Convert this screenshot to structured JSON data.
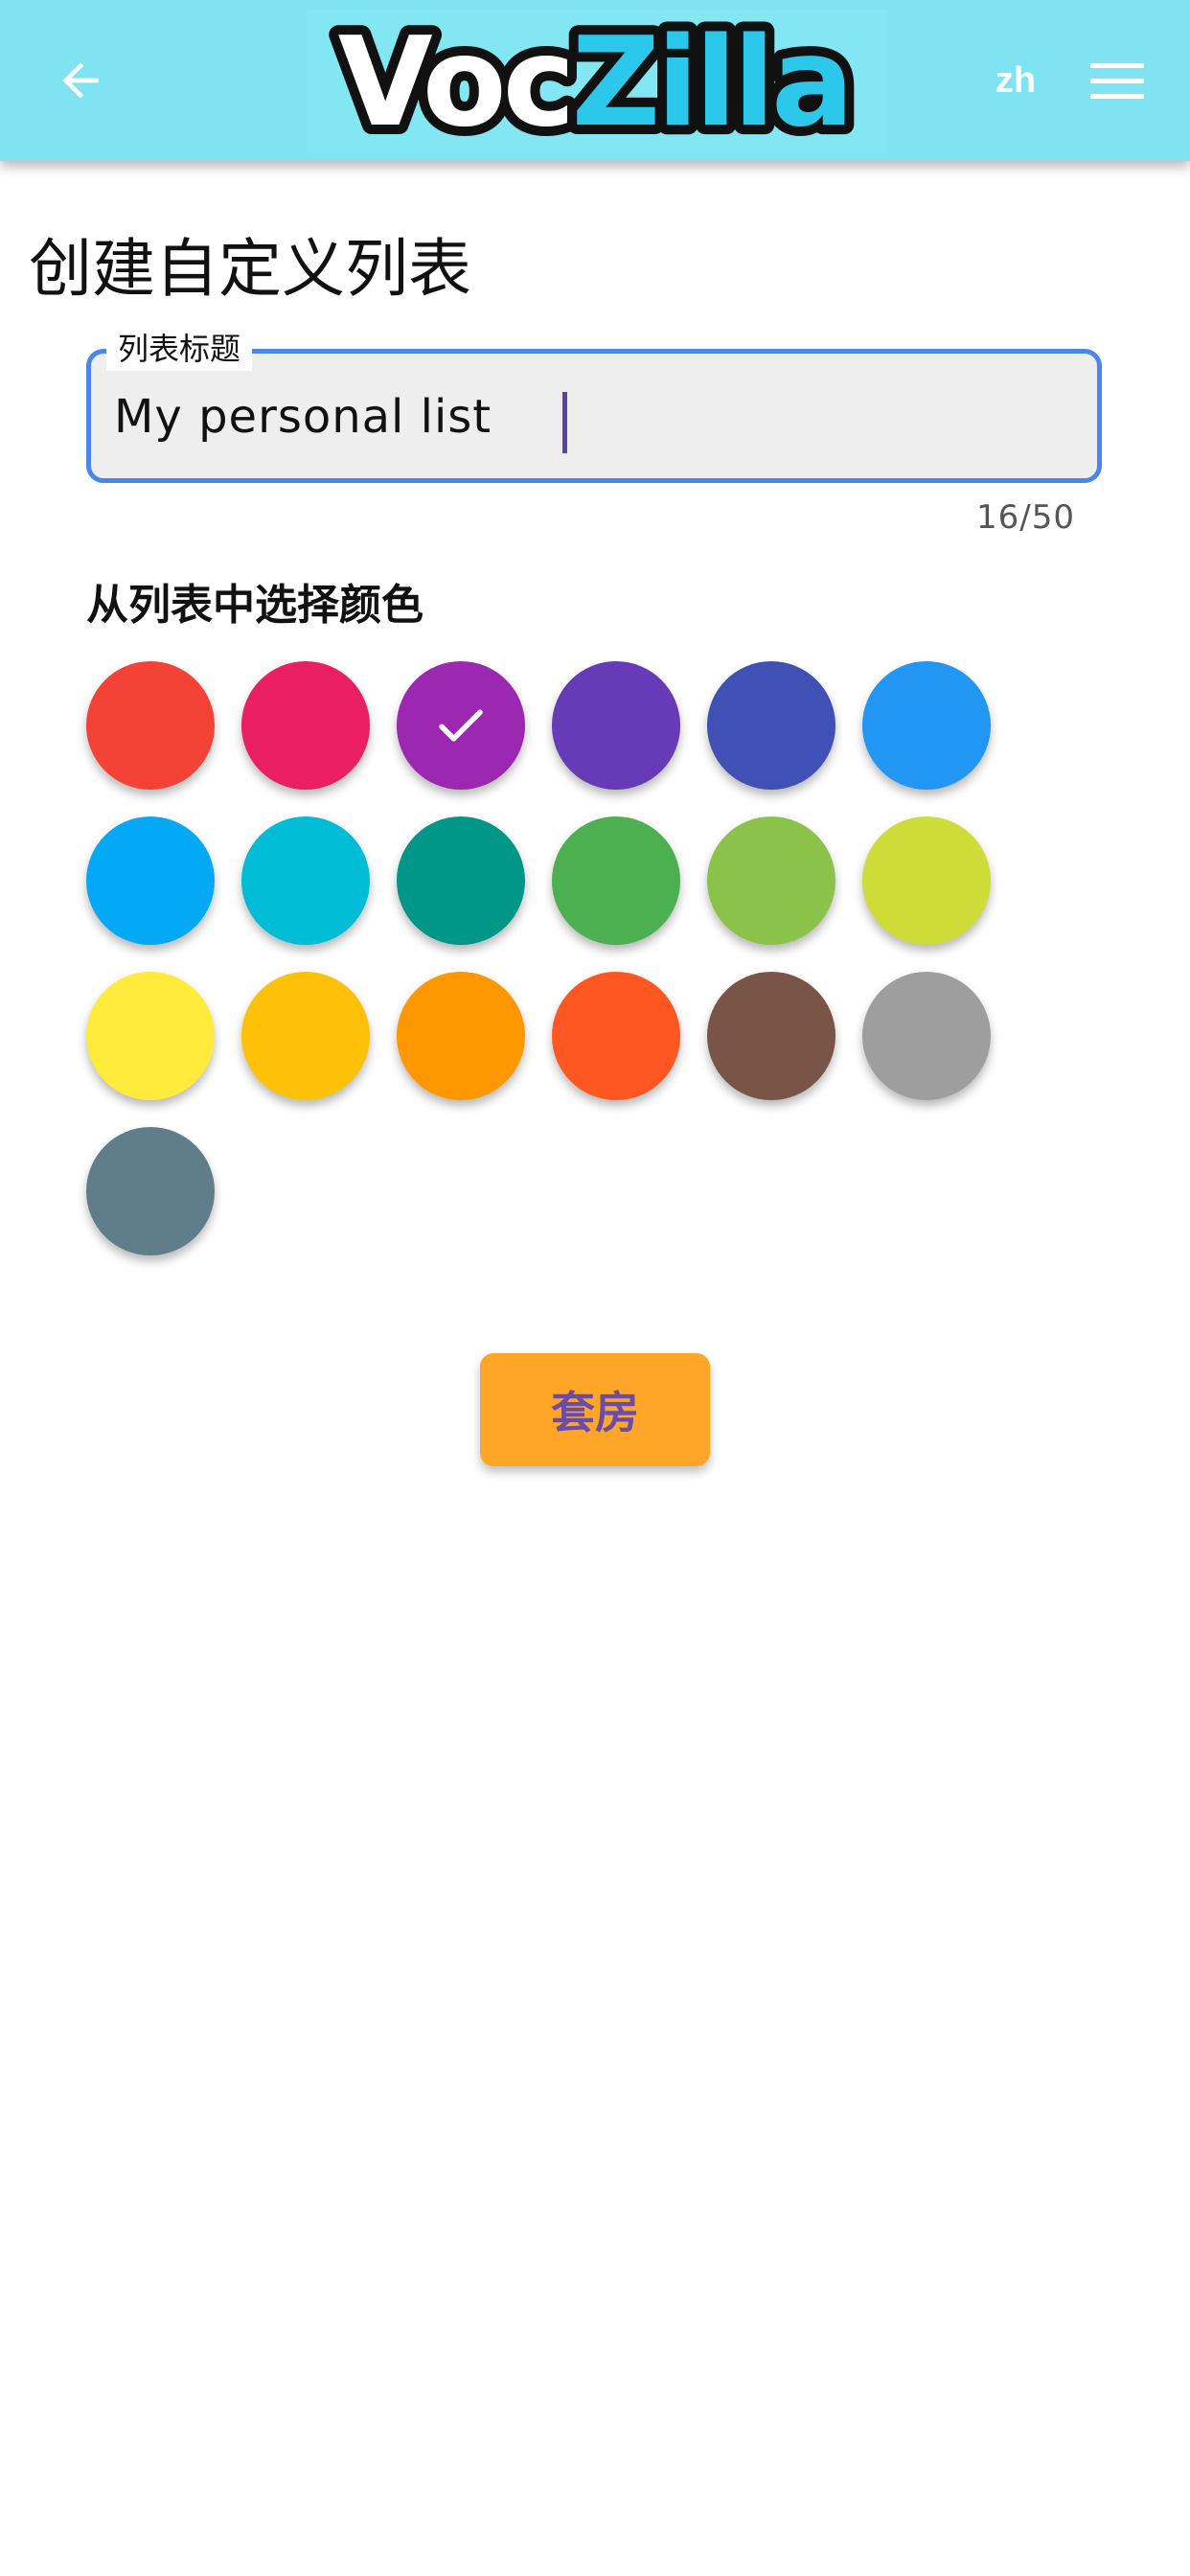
{
  "header": {
    "back_icon": "arrow-left-icon",
    "logo_text_dark": "Voc",
    "logo_text_light": "Zilla",
    "language": "zh",
    "menu_icon": "hamburger-menu-icon",
    "background_color": "#7fe3f1"
  },
  "page": {
    "title": "创建自定义列表"
  },
  "form": {
    "title_field": {
      "label": "列表标题",
      "value": "My personal list",
      "counter": "16/50",
      "max_length": 50
    },
    "color_section_title": "从列表中选择颜色",
    "selected_color_index": 2,
    "colors": [
      {
        "name": "red",
        "hex": "#f44336"
      },
      {
        "name": "pink",
        "hex": "#e91e63"
      },
      {
        "name": "purple",
        "hex": "#9c27b0"
      },
      {
        "name": "deep-purple",
        "hex": "#673ab7"
      },
      {
        "name": "indigo",
        "hex": "#3f51b5"
      },
      {
        "name": "blue",
        "hex": "#2196f3"
      },
      {
        "name": "light-blue",
        "hex": "#03a9f4"
      },
      {
        "name": "cyan",
        "hex": "#00bcd4"
      },
      {
        "name": "teal",
        "hex": "#009688"
      },
      {
        "name": "green",
        "hex": "#4caf50"
      },
      {
        "name": "light-green",
        "hex": "#8bc34a"
      },
      {
        "name": "lime",
        "hex": "#cddc39"
      },
      {
        "name": "yellow",
        "hex": "#ffeb3b"
      },
      {
        "name": "amber",
        "hex": "#ffc107"
      },
      {
        "name": "orange",
        "hex": "#ff9800"
      },
      {
        "name": "deep-orange",
        "hex": "#ff5722"
      },
      {
        "name": "brown",
        "hex": "#795548"
      },
      {
        "name": "grey",
        "hex": "#9e9e9e"
      },
      {
        "name": "blue-grey",
        "hex": "#607d8b"
      }
    ],
    "selected_check_icon": "checkmark-icon",
    "submit_label": "套房",
    "submit_color": "#ffa629"
  }
}
